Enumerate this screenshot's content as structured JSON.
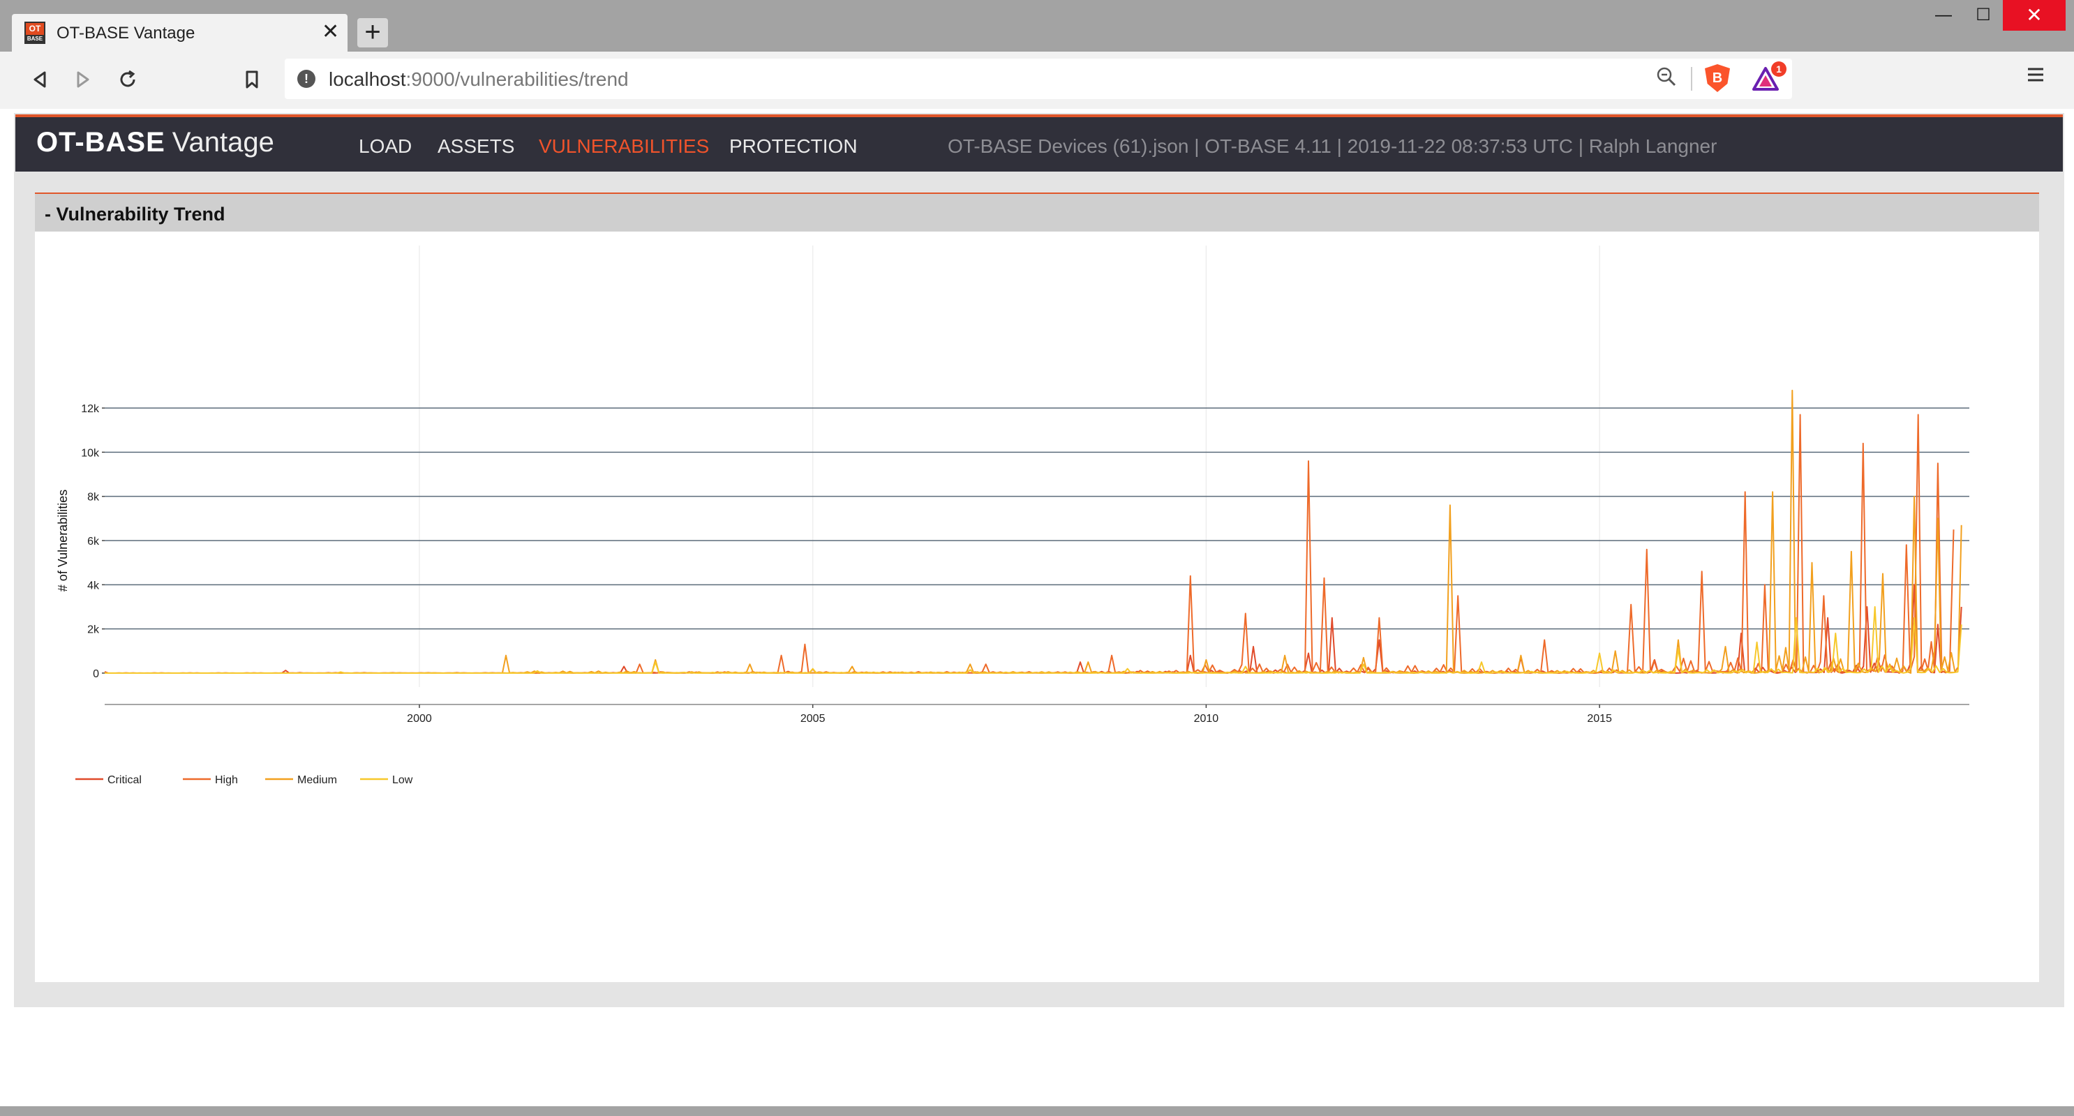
{
  "browser": {
    "tab_title": "OT-BASE Vantage",
    "tab_icon_top": "OT",
    "tab_icon_bottom": "BASE",
    "tab_close": "✕",
    "new_tab": "+",
    "url_host": "localhost",
    "url_rest": ":9000/vulnerabilities/trend",
    "shield_badge": "1",
    "window_controls": {
      "minimize": "—",
      "maximize": "☐",
      "close": "✕"
    }
  },
  "app": {
    "logo_bold": "OT-BASE",
    "logo_light": "Vantage",
    "nav": [
      {
        "label": "LOAD",
        "active": false
      },
      {
        "label": "ASSETS",
        "active": false
      },
      {
        "label": "VULNERABILITIES",
        "active": true
      },
      {
        "label": "PROTECTION",
        "active": false
      }
    ],
    "info": "OT-BASE Devices (61).json | OT-BASE 4.11 | 2019-11-22 08:37:53 UTC | Ralph Langner"
  },
  "panel": {
    "title": "-  Vulnerability Trend"
  },
  "chart_data": {
    "type": "line",
    "title": "",
    "xlabel": "",
    "ylabel": "# of Vulnerabilities",
    "xlim": [
      1996.0,
      2019.7
    ],
    "ylim": [
      0,
      13000
    ],
    "x_ticks": [
      2000,
      2005,
      2010,
      2015
    ],
    "y_ticks": [
      0,
      2000,
      4000,
      6000,
      8000,
      10000,
      12000
    ],
    "y_tick_labels": [
      "0",
      "2k",
      "4k",
      "6k",
      "8k",
      "10k",
      "12k"
    ],
    "grid": true,
    "legend_position": "bottom-left",
    "series": [
      {
        "name": "Critical",
        "color": "#e04a2a",
        "x": [
          1996.0,
          1998.3,
          2002.6,
          2005.0,
          2008.4,
          2009.8,
          2010.6,
          2011.3,
          2011.6,
          2012.2,
          2014.0,
          2015.7,
          2016.8,
          2017.9,
          2018.4,
          2019.0,
          2019.3,
          2019.6
        ],
        "y": [
          60,
          120,
          300,
          180,
          500,
          800,
          1200,
          900,
          2500,
          1500,
          700,
          600,
          1800,
          2500,
          3000,
          4000,
          2200,
          3000
        ]
      },
      {
        "name": "High",
        "color": "#ee6a2a",
        "x": [
          1996.0,
          1999.0,
          2002.8,
          2004.6,
          2004.9,
          2007.2,
          2008.8,
          2009.8,
          2010.5,
          2011.3,
          2011.5,
          2012.2,
          2013.2,
          2014.3,
          2015.4,
          2015.6,
          2016.3,
          2016.85,
          2017.1,
          2017.55,
          2017.85,
          2018.35,
          2018.9,
          2019.05,
          2019.3,
          2019.5
        ],
        "y": [
          40,
          30,
          400,
          800,
          1300,
          400,
          800,
          4400,
          2700,
          9600,
          4300,
          2500,
          3500,
          1500,
          3100,
          5600,
          4600,
          8200,
          4000,
          11700,
          3500,
          10400,
          5800,
          11700,
          9500,
          6500
        ]
      },
      {
        "name": "Medium",
        "color": "#f2a01e",
        "x": [
          1996.0,
          2001.1,
          2003.0,
          2004.2,
          2005.5,
          2007.0,
          2008.5,
          2010.0,
          2011.0,
          2012.0,
          2013.1,
          2014.0,
          2015.2,
          2016.0,
          2016.6,
          2017.2,
          2017.45,
          2017.7,
          2018.2,
          2018.6,
          2019.0,
          2019.3,
          2019.6
        ],
        "y": [
          0,
          800,
          600,
          400,
          300,
          400,
          500,
          600,
          800,
          700,
          7600,
          800,
          1000,
          1500,
          1200,
          8200,
          12800,
          5000,
          5500,
          4500,
          8000,
          7000,
          6700
        ]
      },
      {
        "name": "Low",
        "color": "#f7c82a",
        "x": [
          1996.0,
          1999.0,
          2001.5,
          2003.0,
          2005.0,
          2007.0,
          2009.0,
          2010.5,
          2012.0,
          2013.5,
          2015.0,
          2016.0,
          2017.0,
          2017.5,
          2018.0,
          2018.5,
          2019.0,
          2019.6
        ],
        "y": [
          0,
          50,
          100,
          500,
          200,
          150,
          200,
          300,
          400,
          500,
          900,
          1100,
          1400,
          2500,
          1800,
          3000,
          2500,
          2200
        ]
      }
    ]
  }
}
